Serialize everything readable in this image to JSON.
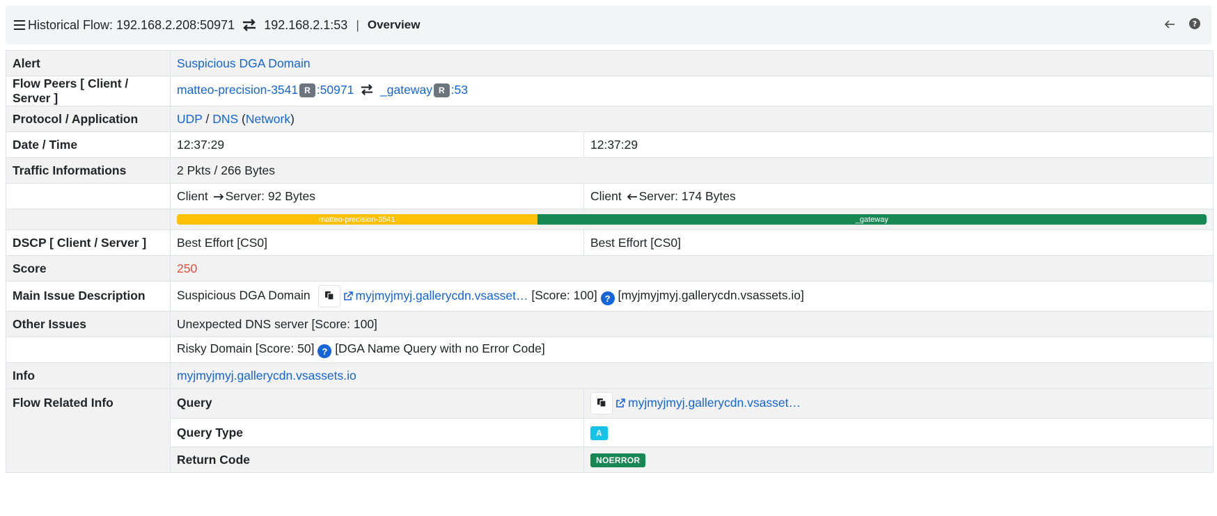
{
  "header": {
    "title": "Historical Flow: 192.168.2.208:50971",
    "dest": "192.168.2.1:53",
    "separator": "|",
    "active_tab": "Overview"
  },
  "rows": {
    "alert": {
      "label": "Alert",
      "value": "Suspicious DGA Domain"
    },
    "peers": {
      "label": "Flow Peers [ Client / Server ]",
      "client_host": "matteo-precision-3541",
      "client_badge": "R",
      "client_port": ":50971",
      "server_host": "_gateway",
      "server_badge": "R",
      "server_port": ":53"
    },
    "protocol": {
      "label": "Protocol / Application",
      "proto": "UDP",
      "slash": " / ",
      "app": "DNS",
      "paren_open": " (",
      "category": "Network",
      "paren_close": ")"
    },
    "datetime": {
      "label": "Date / Time",
      "first": "12:37:29",
      "last": "12:37:29"
    },
    "traffic": {
      "label": "Traffic Informations",
      "summary": "2 Pkts / 266 Bytes",
      "c2s_prefix": "Client",
      "c2s_suffix": "Server: 92 Bytes",
      "s2c_prefix": "Client",
      "s2c_suffix": "Server: 174 Bytes",
      "bar_client_label": "matteo-precision-3541",
      "bar_server_label": "_gateway",
      "bar_client_fraction": 0.35
    },
    "dscp": {
      "label": "DSCP [ Client / Server ]",
      "client": "Best Effort [CS0]",
      "server": "Best Effort [CS0]"
    },
    "score": {
      "label": "Score",
      "value": "250"
    },
    "main_issue": {
      "label": "Main Issue Description",
      "text": "Suspicious DGA Domain",
      "link": "myjmyjmyj.gallerycdn.vsasset…",
      "score": "[Score: 100]",
      "detail": "[myjmyjmyj.gallerycdn.vsassets.io]"
    },
    "other_issues": {
      "label": "Other Issues",
      "issue1": "Unexpected DNS server [Score: 100]",
      "issue2_text": "Risky Domain [Score: 50]",
      "issue2_detail": "[DGA Name Query with no Error Code]"
    },
    "info": {
      "label": "Info",
      "value": "myjmyjmyj.gallerycdn.vsassets.io"
    },
    "related": {
      "label": "Flow Related Info",
      "query_label": "Query",
      "query_value": "myjmyjmyj.gallerycdn.vsasset…",
      "qtype_label": "Query Type",
      "qtype_value": "A",
      "rcode_label": "Return Code",
      "rcode_value": "NOERROR"
    }
  },
  "colors": {
    "link": "#1565d8",
    "score": "#e74c3c",
    "bar_client": "#ffc107",
    "bar_server": "#198754",
    "badge_query_type": "#17c1e8",
    "badge_return_code": "#198754"
  }
}
